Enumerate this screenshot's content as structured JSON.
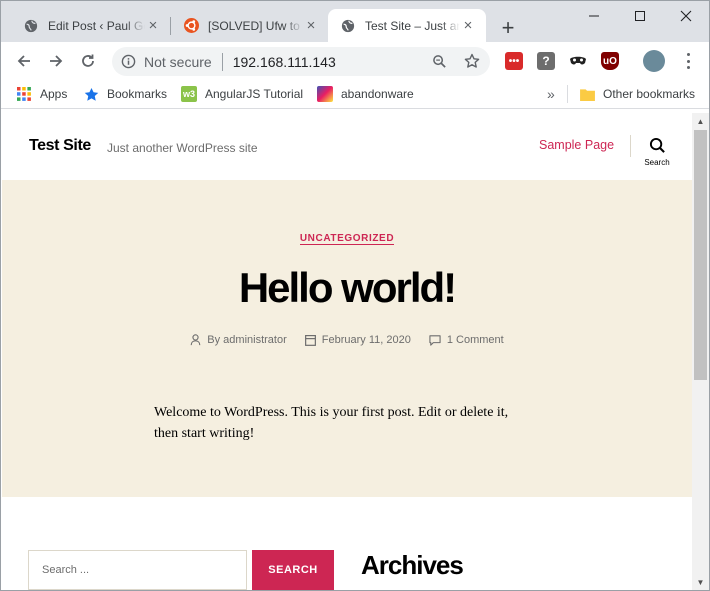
{
  "browser": {
    "tabs": [
      {
        "title": "Edit Post ‹ Paul Ge",
        "favicon": "globe-icon"
      },
      {
        "title": "[SOLVED] Ufw to l",
        "favicon": "ubuntu-icon"
      },
      {
        "title": "Test Site – Just an",
        "favicon": "globe-icon"
      }
    ],
    "new_tab": "+",
    "address": {
      "security": "Not secure",
      "url": "192.168.111.143"
    },
    "bookmarks": [
      {
        "label": "Apps",
        "icon": "apps-grid-icon"
      },
      {
        "label": "Bookmarks",
        "icon": "star-icon"
      },
      {
        "label": "AngularJS Tutorial",
        "icon": "w3-icon"
      },
      {
        "label": "abandonware",
        "icon": "abandonware-icon"
      }
    ],
    "overflow": "»",
    "other_bookmarks": "Other bookmarks"
  },
  "site": {
    "title": "Test Site",
    "description": "Just another WordPress site",
    "nav": [
      "Sample Page"
    ],
    "search_label": "Search"
  },
  "post": {
    "category": "UNCATEGORIZED",
    "title": "Hello world!",
    "author": "By administrator",
    "date": "February 11, 2020",
    "comments": "1 Comment",
    "content": "Welcome to WordPress. This is your first post. Edit or delete it, then start writing!"
  },
  "widgets": {
    "search_placeholder": "Search ...",
    "search_button": "SEARCH",
    "archives_title": "Archives"
  },
  "colors": {
    "accent": "#cd2653",
    "hero_bg": "#f5efe0",
    "tabstrip": "#dee1e6"
  }
}
